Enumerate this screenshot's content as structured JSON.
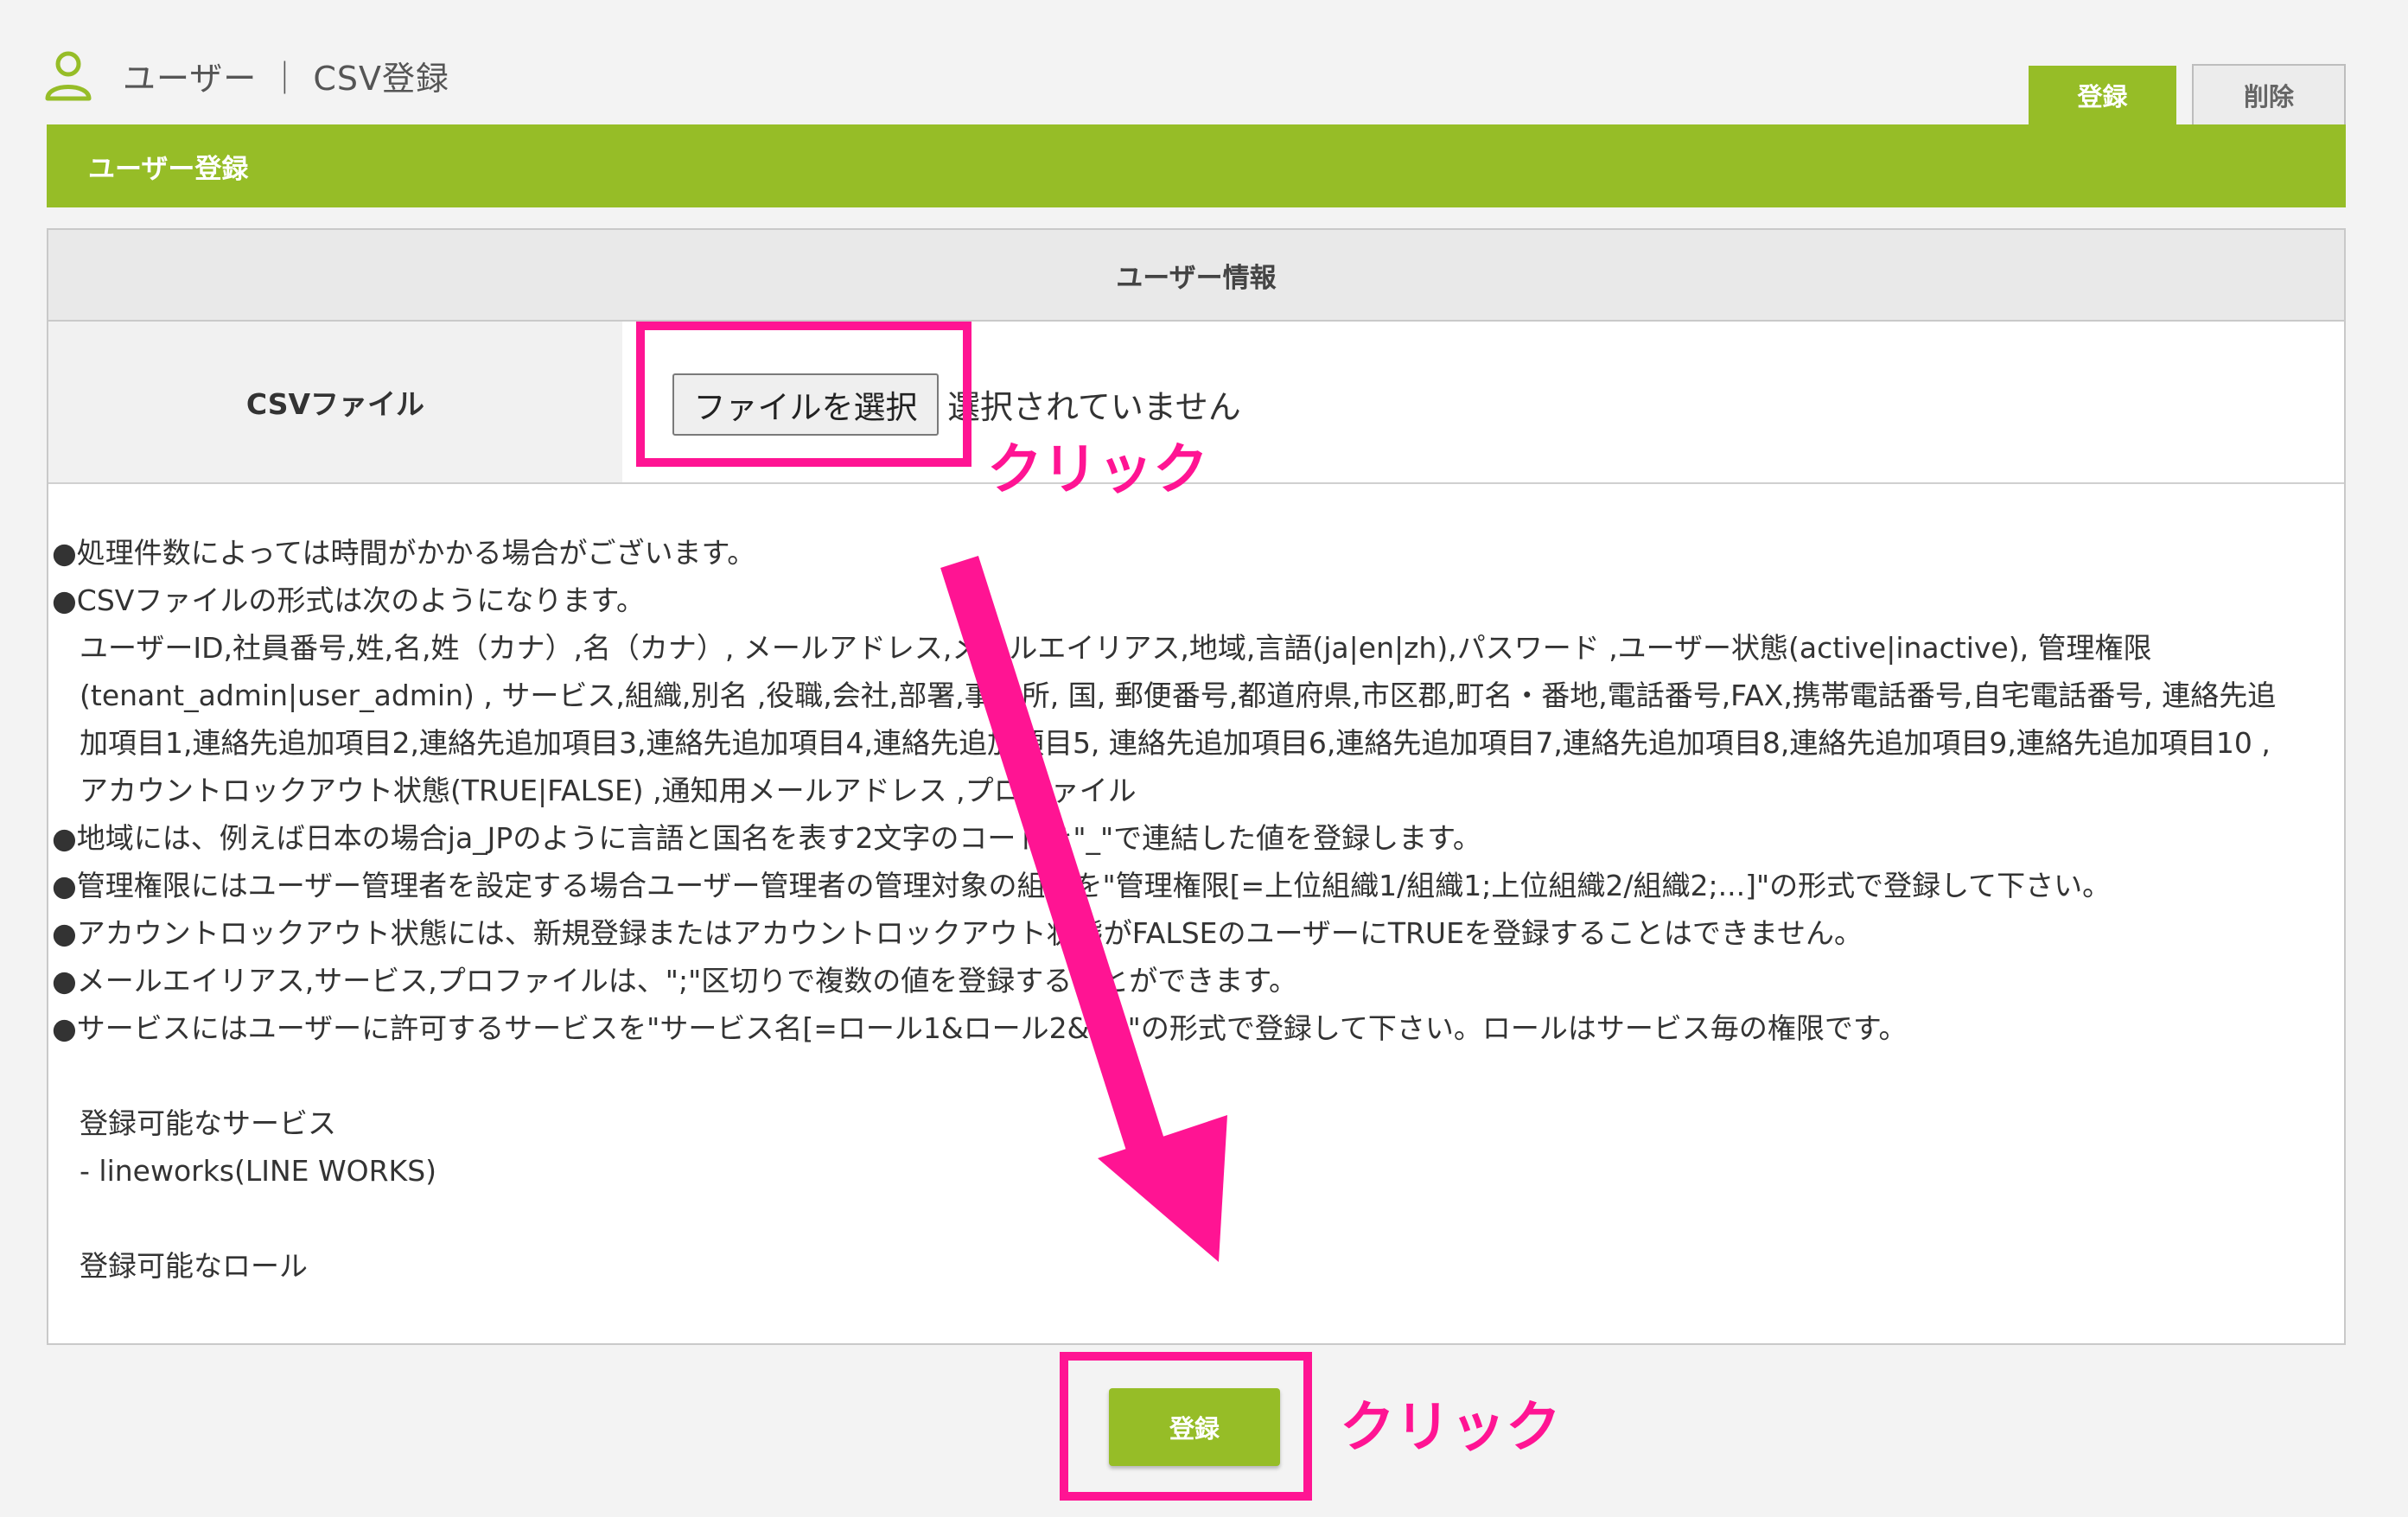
{
  "header": {
    "title": "ユーザー ｜ CSV登録"
  },
  "tabs": {
    "register_label": "登録",
    "delete_label": "削除"
  },
  "section_bar": {
    "title": "ユーザー登録"
  },
  "panel": {
    "head_title": "ユーザー情報",
    "csv_label": "CSVファイル",
    "file_button_label": "ファイルを選択",
    "file_status": "選択されていません"
  },
  "notes": {
    "line1": "●処理件数によっては時間がかかる場合がございます。",
    "line2": "●CSVファイルの形式は次のようになります。",
    "format": "ユーザーID,社員番号,姓,名,姓（カナ）,名（カナ）, メールアドレス,メールエイリアス,地域,言語(ja|en|zh),パスワード ,ユーザー状態(active|inactive), 管理権限 (tenant_admin|user_admin) , サービス,組織,別名 ,役職,会社,部署,事業所, 国, 郵便番号,都道府県,市区郡,町名・番地,電話番号,FAX,携帯電話番号,自宅電話番号, 連絡先追加項目1,連絡先追加項目2,連絡先追加項目3,連絡先追加項目4,連絡先追加項目5, 連絡先追加項目6,連絡先追加項目7,連絡先追加項目8,連絡先追加項目9,連絡先追加項目10 ,アカウントロックアウト状態(TRUE|FALSE) ,通知用メールアドレス ,プロファイル",
    "line3": "●地域には、例えば日本の場合ja_JPのように言語と国名を表す2文字のコードを\"_\"で連結した値を登録します。",
    "line4": "●管理権限にはユーザー管理者を設定する場合ユーザー管理者の管理対象の組織を\"管理権限[=上位組織1/組織1;上位組織2/組織2;...]\"の形式で登録して下さい。",
    "line5": "●アカウントロックアウト状態には、新規登録またはアカウントロックアウト状態がFALSEのユーザーにTRUEを登録することはできません。",
    "line6": "●メールエイリアス,サービス,プロファイルは、\";\"区切りで複数の値を登録することができます。",
    "line7": "●サービスにはユーザーに許可するサービスを\"サービス名[=ロール1&ロール2&...]\"の形式で登録して下さい。ロールはサービス毎の権限です。",
    "services_heading": "登録可能なサービス",
    "services_item": "- lineworks(LINE WORKS)",
    "roles_heading": "登録可能なロール"
  },
  "submit": {
    "label": "登録"
  },
  "annotations": {
    "click_label_1": "クリック",
    "click_label_2": "クリック",
    "highlight_color": "#ff1493"
  },
  "colors": {
    "accent": "#96bd27",
    "background": "#f3f3f3"
  }
}
